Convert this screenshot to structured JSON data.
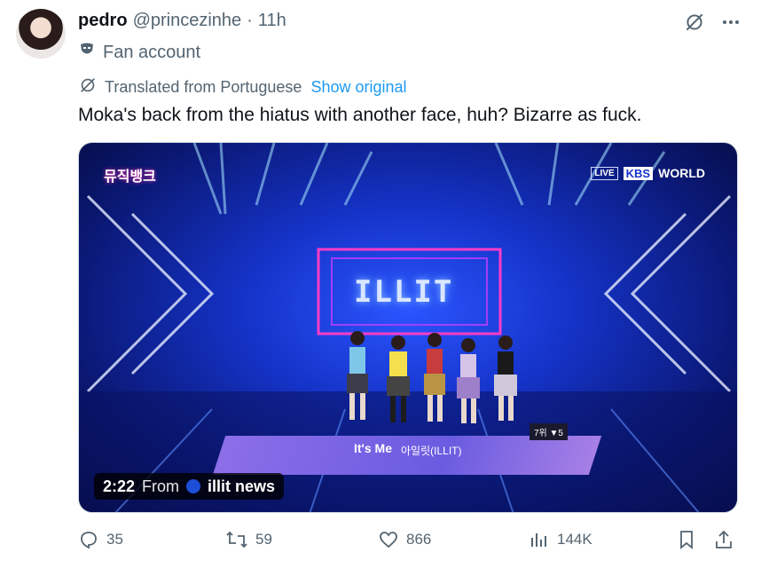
{
  "author": {
    "name": "pedro",
    "handle": "@princezinhe",
    "separator": "·",
    "time": "11h",
    "label": "Fan account"
  },
  "translation": {
    "notice": "Translated from Portuguese",
    "link": "Show original"
  },
  "tweet": {
    "text": "Moka's back from the hiatus with another face, huh? Bizarre as fuck."
  },
  "video": {
    "duration": "2:22",
    "from_label": "From",
    "channel": "illit news",
    "overlay": {
      "broadcaster_live": "LIVE",
      "broadcaster_kbs": "KBS",
      "broadcaster_world": "WORLD",
      "show_logo": "뮤직뱅크",
      "stage_logo": "ILLIT",
      "song": "It's Me",
      "artist": "아일릿(ILLIT)",
      "rank": "7위 ▼5"
    }
  },
  "actions": {
    "replies": "35",
    "reposts": "59",
    "likes": "866",
    "views": "144K"
  },
  "icons": {
    "fan_account": "mask-icon",
    "translate": "translate-icon",
    "grok": "grok-icon",
    "more": "more-icon",
    "reply": "reply-icon",
    "repost": "repost-icon",
    "like": "heart-icon",
    "views": "views-icon",
    "bookmark": "bookmark-icon",
    "share": "share-icon"
  },
  "colors": {
    "text": "#0f1419",
    "secondary": "#536471",
    "link": "#1d9bf0"
  }
}
